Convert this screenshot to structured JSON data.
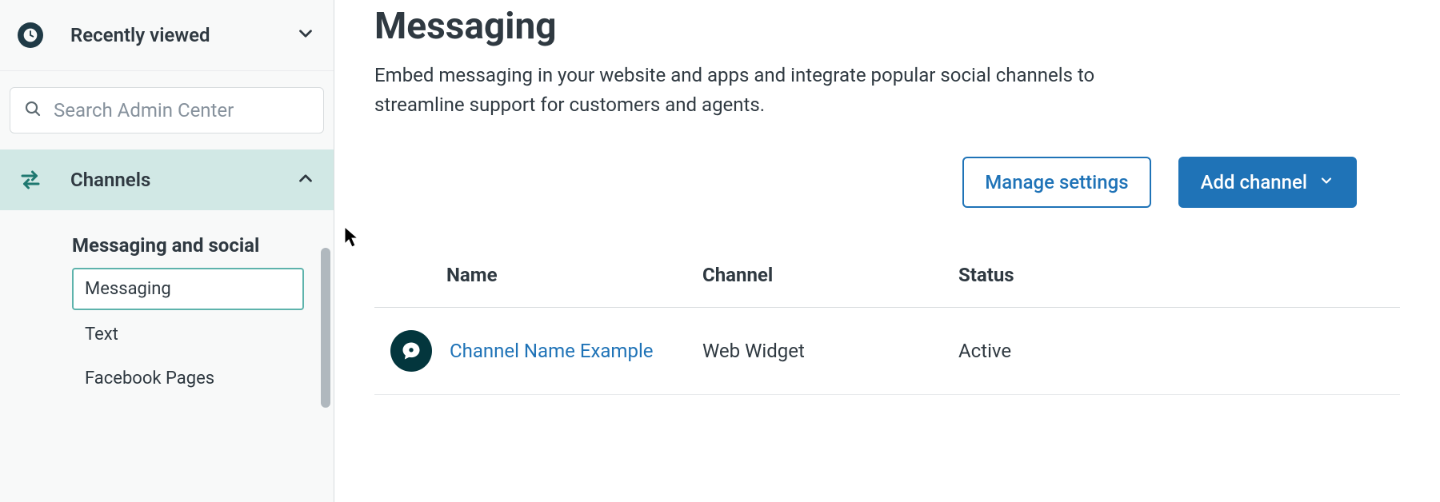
{
  "sidebar": {
    "recently_viewed_label": "Recently viewed",
    "search_placeholder": "Search Admin Center",
    "nav": {
      "channels_label": "Channels"
    },
    "subsection": {
      "title": "Messaging and social",
      "items": [
        {
          "label": "Messaging",
          "selected": true
        },
        {
          "label": "Text",
          "selected": false
        },
        {
          "label": "Facebook Pages",
          "selected": false
        }
      ]
    }
  },
  "main": {
    "title": "Messaging",
    "description": "Embed messaging in your website and apps and integrate popular social channels to streamline support for customers and agents.",
    "buttons": {
      "manage_settings": "Manage settings",
      "add_channel": "Add channel"
    },
    "table": {
      "headers": {
        "name": "Name",
        "channel": "Channel",
        "status": "Status"
      },
      "rows": [
        {
          "name": "Channel Name Example",
          "channel": "Web Widget",
          "status": "Active"
        }
      ]
    }
  }
}
